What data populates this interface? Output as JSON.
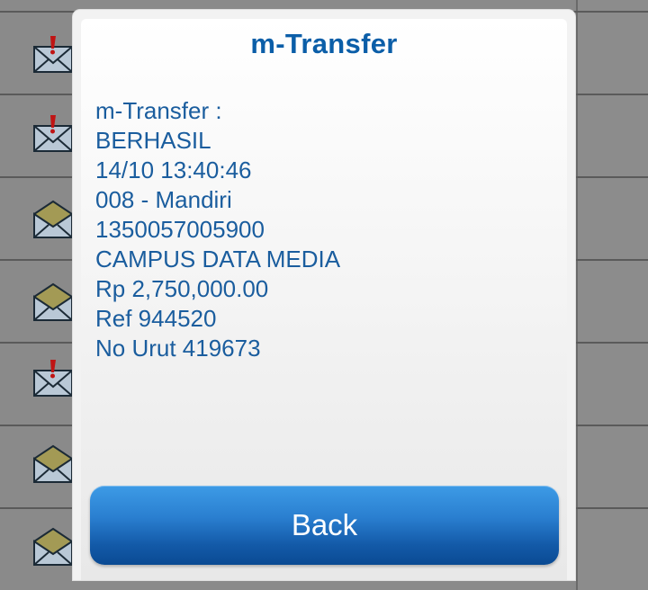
{
  "background_list": {
    "rows": [
      {
        "icon": "envelope-alert-icon"
      },
      {
        "icon": "envelope-alert-icon"
      },
      {
        "icon": "envelope-open-icon"
      },
      {
        "icon": "envelope-open-icon"
      },
      {
        "icon": "envelope-alert-icon"
      },
      {
        "icon": "envelope-open-icon"
      },
      {
        "icon": "envelope-open-icon"
      }
    ]
  },
  "dialog": {
    "title": "m-Transfer",
    "lines": [
      "m-Transfer :",
      "BERHASIL",
      "14/10 13:40:46",
      "008 - Mandiri",
      "1350057005900",
      "CAMPUS DATA MEDIA",
      "Rp 2,750,000.00",
      "Ref 944520",
      "No Urut 419673"
    ],
    "back_label": "Back"
  },
  "colors": {
    "title": "#0b5ea8",
    "body_text": "#1a5d9e",
    "button_top": "#3d9be6",
    "button_bottom": "#0a4a93"
  }
}
